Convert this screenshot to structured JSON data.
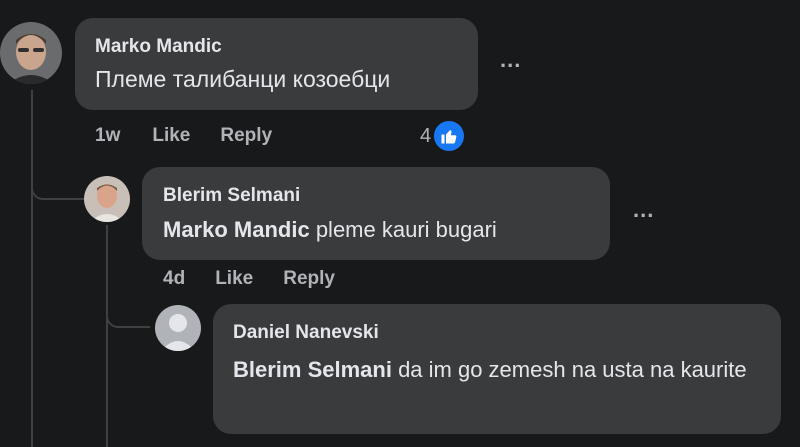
{
  "comments": [
    {
      "author": "Marko Mandic",
      "mention": "",
      "text": "Племе талибанци козоебци",
      "time": "1w",
      "like_label": "Like",
      "reply_label": "Reply",
      "reaction_count": "4",
      "reaction_type": "like-icon"
    },
    {
      "author": "Blerim Selmani",
      "mention": "Marko Mandic",
      "text": " pleme kauri bugari",
      "time": "4d",
      "like_label": "Like",
      "reply_label": "Reply"
    },
    {
      "author": "Daniel Nanevski",
      "mention": "Blerim Selmani",
      "text": " da im go zemesh na usta na kaurite"
    }
  ],
  "more_label": "...",
  "colors": {
    "background": "#18191a",
    "bubble": "#3a3b3c",
    "text": "#e4e6eb",
    "muted": "#b0b3b8",
    "accent": "#1877f2",
    "thread_line": "#3e4042"
  }
}
